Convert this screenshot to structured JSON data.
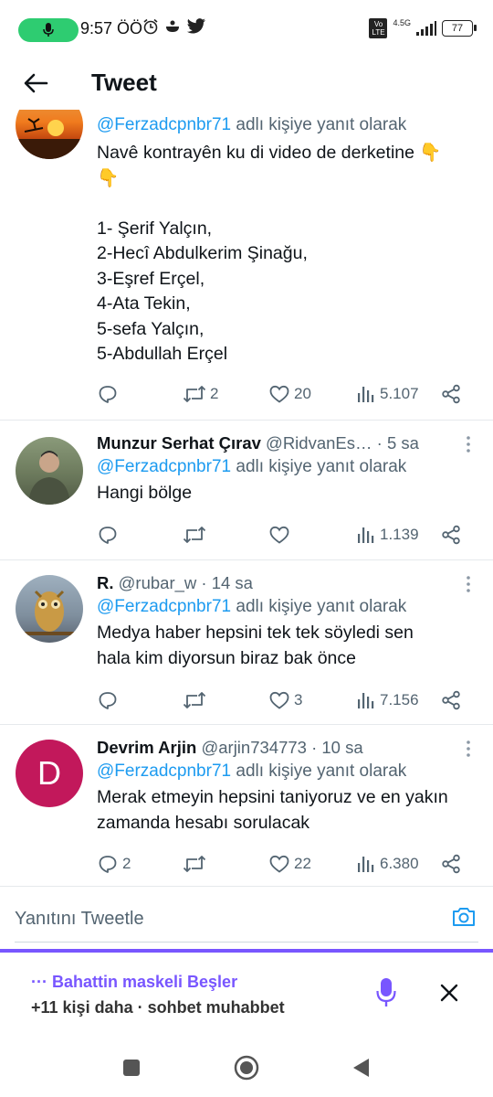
{
  "status_bar": {
    "time": "9:57 ÖÖ",
    "network": "4.5G",
    "volte": "Vo LTE",
    "battery": "77"
  },
  "header": {
    "title": "Tweet"
  },
  "first_tweet": {
    "reply_prefix": "@Ferzadcpnbr71",
    "reply_suffix": " adlı kişiye yanıt olarak",
    "body": "Navê kontrayên ku di video de derketine 👇\n👇\n\n1- Şerif Yalçın,\n2-Hecî Abdulkerim Şinağu,\n3-Eşref Erçel,\n4-Ata Tekin,\n5-sefa Yalçın,\n5-Abdullah Erçel",
    "retweets": "2",
    "likes": "20",
    "views": "5.107"
  },
  "tweets": [
    {
      "name": "Munzur Serhat Çırav",
      "handle": "@RidvanEs…",
      "time": " · 5 sa",
      "reply_prefix": "@Ferzadcpnbr71",
      "reply_suffix": " adlı kişiye yanıt olarak",
      "body": "Hangi bölge",
      "replies": "",
      "retweets": "",
      "likes": "",
      "views": "1.139"
    },
    {
      "name": "R.",
      "handle": "@rubar_w",
      "time": " · 14 sa",
      "reply_prefix": "@Ferzadcpnbr71",
      "reply_suffix": " adlı kişiye yanıt olarak",
      "body": "Medya haber hepsini tek tek söyledi sen\nhala kim diyorsun biraz bak önce",
      "replies": "",
      "retweets": "",
      "likes": "3",
      "views": "7.156"
    },
    {
      "name": "Devrim Arjin",
      "handle": "@arjin734773",
      "time": " · 10 sa",
      "avatar_letter": "D",
      "reply_prefix": "@Ferzadcpnbr71",
      "reply_suffix": " adlı kişiye yanıt olarak",
      "body": "Merak etmeyin hepsini taniyoruz ve en yakın\nzamanda hesabı sorulacak",
      "replies": "2",
      "retweets": "",
      "likes": "22",
      "views": "6.380"
    }
  ],
  "reply_box": {
    "placeholder": "Yanıtını Tweetle"
  },
  "spaces_bar": {
    "title": "Bahattin maskeli Beşler",
    "subtitle": "+11 kişi daha · sohbet muhabbet"
  },
  "colors": {
    "accent": "#1d9bf0",
    "spaces": "#7856ff",
    "avatar_d": "#c2185b"
  }
}
